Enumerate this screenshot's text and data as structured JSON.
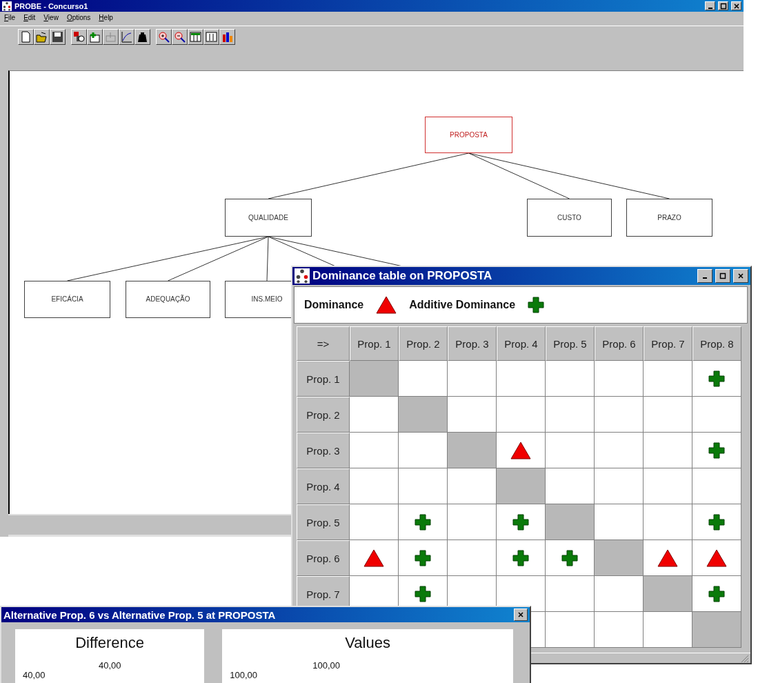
{
  "main_window": {
    "title": "PROBE - Concurso1",
    "menu": [
      "File",
      "Edit",
      "View",
      "Options",
      "Help"
    ],
    "tree": {
      "label": "PROPOSTA",
      "selected": true,
      "children": [
        {
          "label": "QUALIDADE",
          "selected": false,
          "children": [
            {
              "label": "EFICÁCIA",
              "selected": false
            },
            {
              "label": "ADEQUAÇÃO",
              "selected": false
            },
            {
              "label": "INS.MEIO",
              "selected": false
            }
          ]
        },
        {
          "label": "CUSTO",
          "selected": false
        },
        {
          "label": "PRAZO",
          "selected": false
        }
      ]
    }
  },
  "dominance_window": {
    "title": "Dominance table on PROPOSTA",
    "legend": [
      {
        "label": "Dominance",
        "kind": "triangle"
      },
      {
        "label": "Additive Dominance",
        "kind": "plus"
      }
    ],
    "corner": "=>",
    "columns": [
      "Prop. 1",
      "Prop. 2",
      "Prop. 3",
      "Prop. 4",
      "Prop. 5",
      "Prop. 6",
      "Prop. 7",
      "Prop. 8"
    ],
    "rows": [
      {
        "label": "Prop. 1",
        "cells": [
          {
            "kind": "diagonal"
          },
          {
            "kind": "empty"
          },
          {
            "kind": "empty"
          },
          {
            "kind": "empty"
          },
          {
            "kind": "empty"
          },
          {
            "kind": "empty"
          },
          {
            "kind": "empty"
          },
          {
            "kind": "plus"
          }
        ]
      },
      {
        "label": "Prop. 2",
        "cells": [
          {
            "kind": "empty"
          },
          {
            "kind": "diagonal"
          },
          {
            "kind": "empty"
          },
          {
            "kind": "empty"
          },
          {
            "kind": "empty"
          },
          {
            "kind": "empty"
          },
          {
            "kind": "empty"
          },
          {
            "kind": "empty"
          }
        ]
      },
      {
        "label": "Prop. 3",
        "cells": [
          {
            "kind": "empty"
          },
          {
            "kind": "empty"
          },
          {
            "kind": "diagonal"
          },
          {
            "kind": "triangle"
          },
          {
            "kind": "empty"
          },
          {
            "kind": "empty"
          },
          {
            "kind": "empty"
          },
          {
            "kind": "plus"
          }
        ]
      },
      {
        "label": "Prop. 4",
        "cells": [
          {
            "kind": "empty"
          },
          {
            "kind": "empty"
          },
          {
            "kind": "empty"
          },
          {
            "kind": "diagonal"
          },
          {
            "kind": "empty"
          },
          {
            "kind": "empty"
          },
          {
            "kind": "empty"
          },
          {
            "kind": "empty"
          }
        ]
      },
      {
        "label": "Prop. 5",
        "cells": [
          {
            "kind": "empty"
          },
          {
            "kind": "plus"
          },
          {
            "kind": "empty"
          },
          {
            "kind": "plus"
          },
          {
            "kind": "diagonal"
          },
          {
            "kind": "empty"
          },
          {
            "kind": "empty"
          },
          {
            "kind": "plus"
          }
        ]
      },
      {
        "label": "Prop. 6",
        "cells": [
          {
            "kind": "triangle"
          },
          {
            "kind": "plus"
          },
          {
            "kind": "empty"
          },
          {
            "kind": "plus"
          },
          {
            "kind": "plus"
          },
          {
            "kind": "diagonal"
          },
          {
            "kind": "triangle"
          },
          {
            "kind": "triangle"
          }
        ]
      },
      {
        "label": "Prop. 7",
        "cells": [
          {
            "kind": "empty"
          },
          {
            "kind": "plus"
          },
          {
            "kind": "empty"
          },
          {
            "kind": "empty"
          },
          {
            "kind": "empty"
          },
          {
            "kind": "empty"
          },
          {
            "kind": "diagonal"
          },
          {
            "kind": "plus"
          }
        ]
      },
      {
        "cells": [
          {
            "kind": "empty"
          },
          {
            "kind": "empty"
          },
          {
            "kind": "empty"
          },
          {
            "kind": "empty"
          },
          {
            "kind": "diagonal"
          }
        ]
      }
    ]
  },
  "comparison_window": {
    "title": "Alternative Prop. 6 vs Alternative Prop. 5 at PROPOSTA",
    "panels": [
      {
        "title": "Difference",
        "axis_label": "40,00",
        "value_label": "40,00"
      },
      {
        "title": "Values",
        "axis_label": "100,00",
        "value_label": "100,00"
      }
    ]
  }
}
